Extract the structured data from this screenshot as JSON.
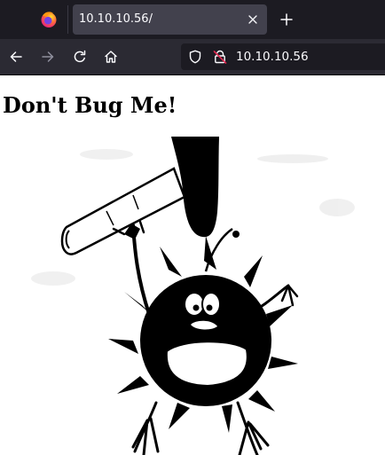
{
  "browser": {
    "tab": {
      "title": "10.10.10.56/",
      "close_icon": "close-icon"
    },
    "new_tab_icon": "plus-icon",
    "nav": {
      "back_icon": "arrow-left-icon",
      "forward_icon": "arrow-right-icon",
      "reload_icon": "reload-icon",
      "home_icon": "home-icon"
    },
    "urlbar": {
      "url": "10.10.10.56",
      "tracking_icon": "shield-icon",
      "security_icon": "lock-insecure-icon"
    },
    "colors": {
      "tabbar_bg": "#1c1b22",
      "tab_bg": "#42414d",
      "toolbar_bg": "#2b2a33",
      "urlbar_bg": "#1c1b22",
      "text": "#fbfbfe",
      "insecure_accent": "#e22850"
    }
  },
  "page": {
    "heading": "Don't Bug Me!",
    "image_icon": "bug-with-hammer-illustration"
  }
}
